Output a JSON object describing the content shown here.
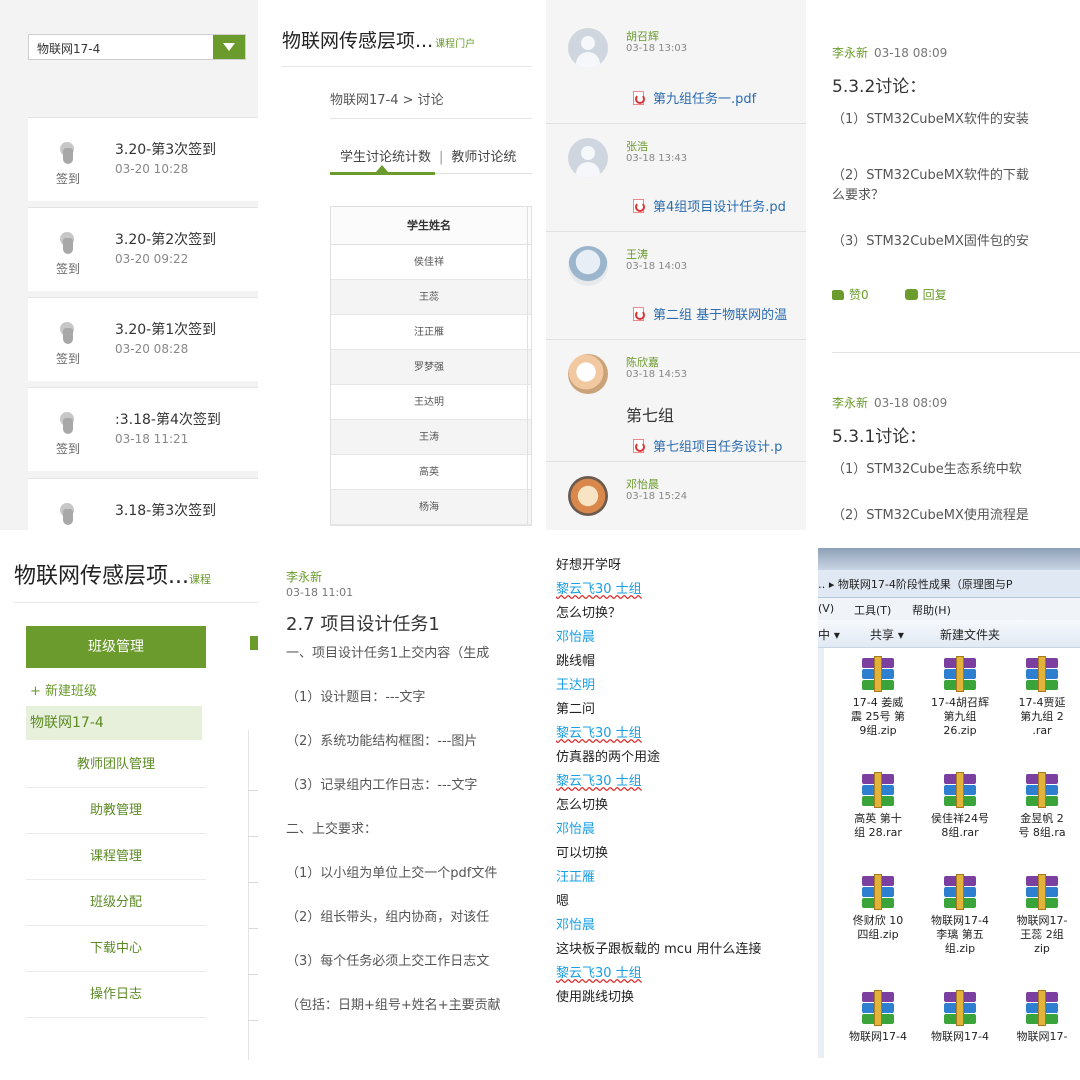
{
  "signin": {
    "course_select": "物联网17-4",
    "items": [
      {
        "label": "签到",
        "title": "3.20-第3次签到",
        "date": "03-20 10:28"
      },
      {
        "label": "签到",
        "title": "3.20-第2次签到",
        "date": "03-20 09:22"
      },
      {
        "label": "签到",
        "title": "3.20-第1次签到",
        "date": "03-20 08:28"
      },
      {
        "label": "签到",
        "title": ":3.18-第4次签到",
        "date": "03-18 11:21"
      },
      {
        "label": "",
        "title": "3.18-第3次签到",
        "date": ""
      }
    ]
  },
  "discussion_stats": {
    "title": "物联网传感层项...",
    "title_link": "课程门户",
    "breadcrumb": "物联网17-4 > 讨论",
    "tab_student": "学生讨论统计数",
    "tab_sep": "|",
    "tab_teacher": "教师讨论统",
    "col_header": "学生姓名",
    "students": [
      "侯佳祥",
      "王蕊",
      "汪正雁",
      "罗梦强",
      "王达明",
      "王涛",
      "高英",
      "杨海"
    ]
  },
  "file_posts": [
    {
      "name": "胡召辉",
      "time": "03-18 13:03",
      "body": "",
      "file": "第九组任务一.pdf"
    },
    {
      "name": "张浩",
      "time": "03-18 13:43",
      "body": "",
      "file": "第4组项目设计任务.pd"
    },
    {
      "name": "王涛",
      "time": "03-18 14:03",
      "body": "",
      "file": "第二组 基于物联网的温"
    },
    {
      "name": "陈欣嘉",
      "time": "03-18 14:53",
      "body": "第七组",
      "file": "第七组项目任务设计.p"
    },
    {
      "name": "邓怡晨",
      "time": "03-18 15:24",
      "body": "",
      "file": ""
    }
  ],
  "topics": [
    {
      "author": "李永新",
      "time": "03-18 08:09",
      "heading": "5.3.2讨论：",
      "questions": [
        "（1）STM32CubeMX软件的安装",
        "（2）STM32CubeMX软件的下载",
        "么要求？",
        "（3）STM32CubeMX固件包的安"
      ],
      "like": "赞0",
      "reply": "回复"
    },
    {
      "author": "李永新",
      "time": "03-18 08:09",
      "heading": "5.3.1讨论：",
      "questions": [
        "（1）STM32Cube生态系统中软",
        "（2）STM32CubeMX使用流程是"
      ]
    }
  ],
  "admin": {
    "title": "物联网传感层项...",
    "title_link": "课程",
    "nav_head": "班级管理",
    "new_class": "+ 新建班级",
    "current_class": "物联网17-4",
    "nav_items": [
      "教师团队管理",
      "助教管理",
      "课程管理",
      "班级分配",
      "下载中心",
      "操作日志"
    ]
  },
  "task": {
    "author": "李永新",
    "time": "03-18 11:01",
    "heading": "2.7 项目设计任务1",
    "lines": [
      "一、项目设计任务1上交内容（生成",
      "（1）设计题目：---文字",
      "（2）系统功能结构框图：---图片",
      "（3）记录组内工作日志：---文字",
      "二、上交要求：",
      "（1）以小组为单位上交一个pdf文件",
      "（2）组长带头，组内协商，对该任",
      "（3）每个任务必须上交工作日志文",
      "（包括：日期+组号+姓名+主要贡献"
    ]
  },
  "chat": [
    {
      "k": "m",
      "t": "好想开学呀"
    },
    {
      "k": "nu",
      "t": "黎云飞30 士组"
    },
    {
      "k": "m",
      "t": "怎么切换？"
    },
    {
      "k": "n",
      "t": "邓怡晨"
    },
    {
      "k": "m",
      "t": "跳线帽"
    },
    {
      "k": "n",
      "t": "王达明"
    },
    {
      "k": "m",
      "t": "第二问"
    },
    {
      "k": "nu",
      "t": "黎云飞30 士组"
    },
    {
      "k": "m",
      "t": "仿真器的两个用途"
    },
    {
      "k": "nu",
      "t": "黎云飞30 士组"
    },
    {
      "k": "m",
      "t": "怎么切换"
    },
    {
      "k": "n",
      "t": "邓怡晨"
    },
    {
      "k": "m",
      "t": "可以切换"
    },
    {
      "k": "n",
      "t": "汪正雁"
    },
    {
      "k": "m",
      "t": "嗯"
    },
    {
      "k": "n",
      "t": "邓怡晨"
    },
    {
      "k": "m",
      "t": "这块板子跟板载的 mcu 用什么连接"
    },
    {
      "k": "nu",
      "t": "黎云飞30 士组"
    },
    {
      "k": "m",
      "t": "使用跳线切换"
    }
  ],
  "explorer": {
    "address": "‥ ▸ 物联网17-4阶段性成果（原理图与P",
    "menu": [
      "(V)",
      "工具(T)",
      "帮助(H)"
    ],
    "toolbar": [
      "中 ▾",
      "共享 ▾",
      "新建文件夹"
    ],
    "files": [
      [
        "17-4 姜威",
        "震 25号 第",
        "9组.zip"
      ],
      [
        "17-4胡召辉",
        "第九组",
        "26.zip"
      ],
      [
        "17-4贾延",
        "第九组 2",
        ".rar"
      ],
      [
        "高英 第十",
        "组 28.rar"
      ],
      [
        "侯佳祥24号",
        "8组.rar"
      ],
      [
        "金昱帆 2",
        "号 8组.ra"
      ],
      [
        "佟财欣 10",
        "四组.zip"
      ],
      [
        "物联网17-4",
        "李璃 第五",
        "组.zip"
      ],
      [
        "物联网17-",
        "王蕊 2组",
        "zip"
      ],
      [
        "物联网17-4"
      ],
      [
        "物联网17-4"
      ],
      [
        "物联网17-"
      ]
    ]
  }
}
